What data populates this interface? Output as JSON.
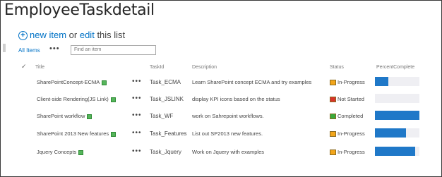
{
  "page": {
    "title": "EmployeeTaskdetail"
  },
  "toolbar": {
    "new_item": "new item",
    "or": "or",
    "edit": "edit",
    "this_list": "this list"
  },
  "view": {
    "all_items": "All Items",
    "more": "•••",
    "search_placeholder": "Find an item"
  },
  "columns": {
    "check": "✓",
    "title": "Title",
    "taskid": "TaskId",
    "description": "Description",
    "status": "Status",
    "percent": "PercentComplete"
  },
  "colors": {
    "link": "#0072c6",
    "bar": "#1f78c8",
    "in_progress": "#f2a51a",
    "not_started": "#d9332a",
    "completed": "#37a93a",
    "new_badge": "#56b55b"
  },
  "rows": [
    {
      "title": "SharePointConcept-ECMA",
      "taskid": "Task_ECMA",
      "description": "Learn SharePoint concept ECMA and try examples",
      "status": "In-Progress",
      "status_icon": "in-progress-icon",
      "percent": 0.3
    },
    {
      "title": "Client-side Rendering(JS Link)",
      "taskid": "Task_JSLINK",
      "description": "display KPI icons based on the status",
      "status": "Not Started",
      "status_icon": "not-started-icon",
      "percent": 0
    },
    {
      "title": "SharePoint workflow",
      "taskid": "Task_WF",
      "description": "work on Sahrepoint workflows.",
      "status": "Completed",
      "status_icon": "completed-icon",
      "percent": 1.0
    },
    {
      "title": "SharePoint 2013 New features",
      "taskid": "Task_Features",
      "description": "List out SP2013 new features.",
      "status": "In-Progress",
      "status_icon": "in-progress-icon",
      "percent": 0.7
    },
    {
      "title": "Jquery Concepts",
      "taskid": "Task_Jquery",
      "description": "Work on Jquery with examples",
      "status": "In-Progress",
      "status_icon": "in-progress-icon",
      "percent": 0.9
    }
  ]
}
